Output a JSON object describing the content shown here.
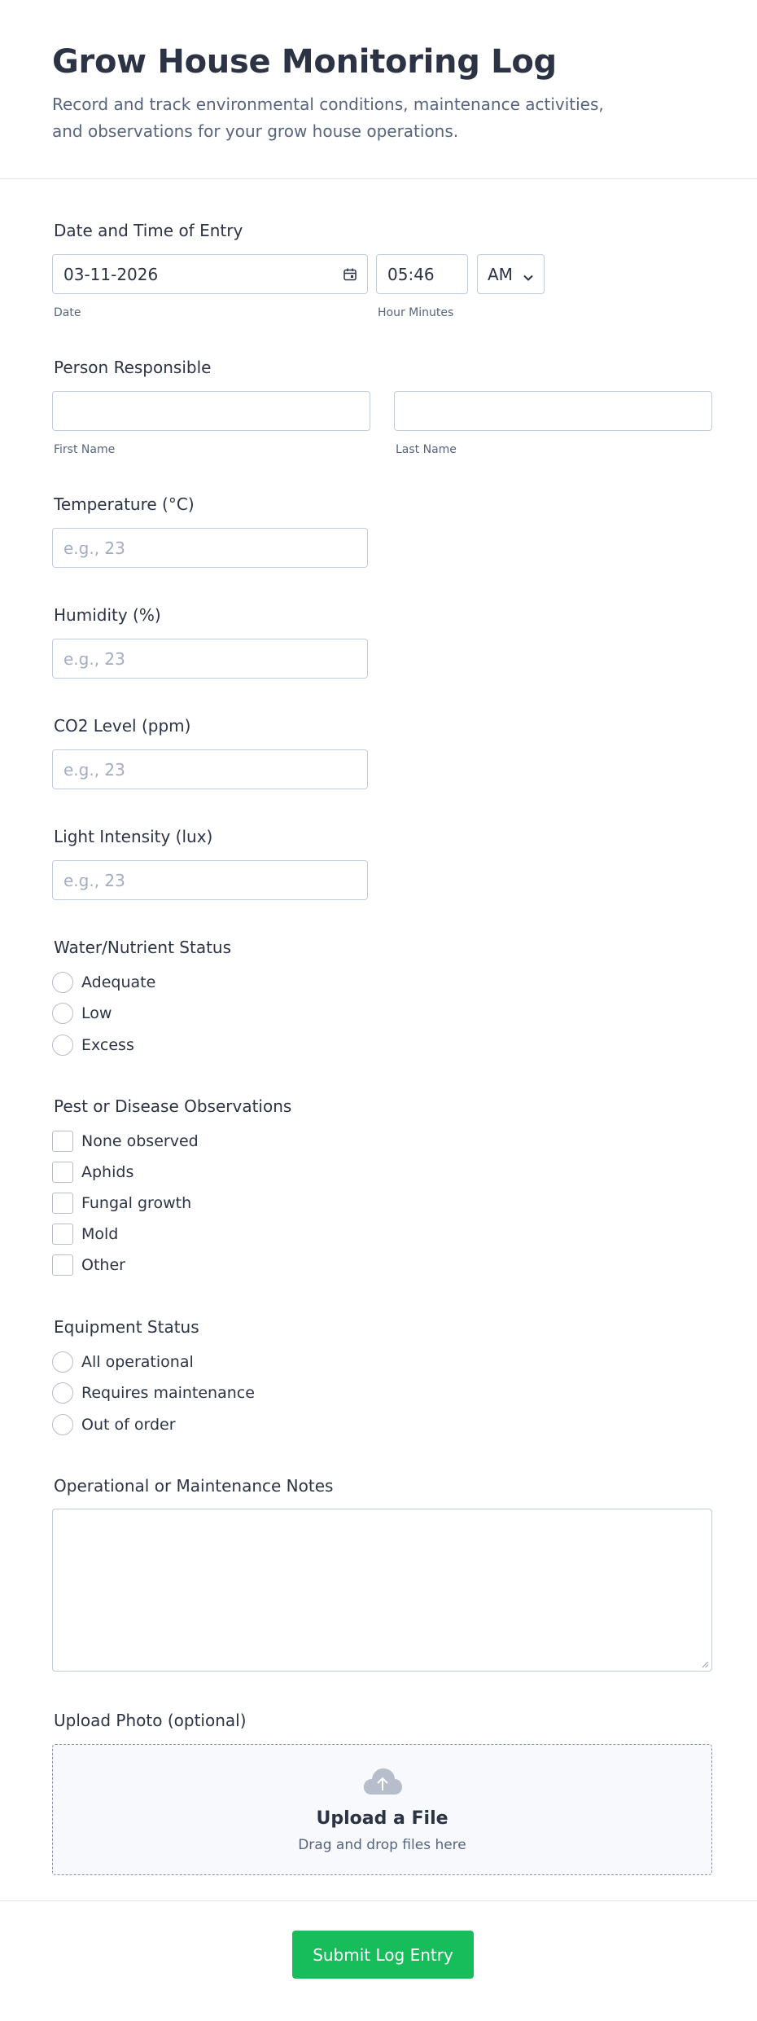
{
  "header": {
    "title": "Grow House Monitoring Log",
    "subtitle": "Record and track environmental conditions, maintenance activities, and observations for your grow house operations."
  },
  "datetime": {
    "label": "Date and Time of Entry",
    "date_value": "03-11-2026",
    "date_sublabel": "Date",
    "time_value": "05:46",
    "time_sublabel": "Hour Minutes",
    "ampm_value": "AM",
    "calendar_icon": "calendar-icon",
    "dropdown_icon": "chevron-down-icon"
  },
  "person": {
    "label": "Person Responsible",
    "first_value": "",
    "first_sublabel": "First Name",
    "last_value": "",
    "last_sublabel": "Last Name"
  },
  "temperature": {
    "label": "Temperature (°C)",
    "placeholder": "e.g., 23"
  },
  "humidity": {
    "label": "Humidity (%)",
    "placeholder": "e.g., 23"
  },
  "co2": {
    "label": "CO2 Level (ppm)",
    "placeholder": "e.g., 23"
  },
  "light": {
    "label": "Light Intensity (lux)",
    "placeholder": "e.g., 23"
  },
  "water": {
    "label": "Water/Nutrient Status",
    "options": [
      "Adequate",
      "Low",
      "Excess"
    ]
  },
  "pest": {
    "label": "Pest or Disease Observations",
    "options": [
      "None observed",
      "Aphids",
      "Fungal growth",
      "Mold",
      "Other"
    ]
  },
  "equipment": {
    "label": "Equipment Status",
    "options": [
      "All operational",
      "Requires maintenance",
      "Out of order"
    ]
  },
  "notes": {
    "label": "Operational or Maintenance Notes",
    "value": ""
  },
  "upload": {
    "label": "Upload Photo (optional)",
    "title": "Upload a File",
    "hint": "Drag and drop files here",
    "icon": "cloud-upload-icon"
  },
  "submit": {
    "label": "Submit Log Entry"
  },
  "colors": {
    "primary_text": "#2c3345",
    "secondary_text": "#57647e",
    "border": "#c3cad8",
    "submit_bg": "#18bd5b"
  }
}
